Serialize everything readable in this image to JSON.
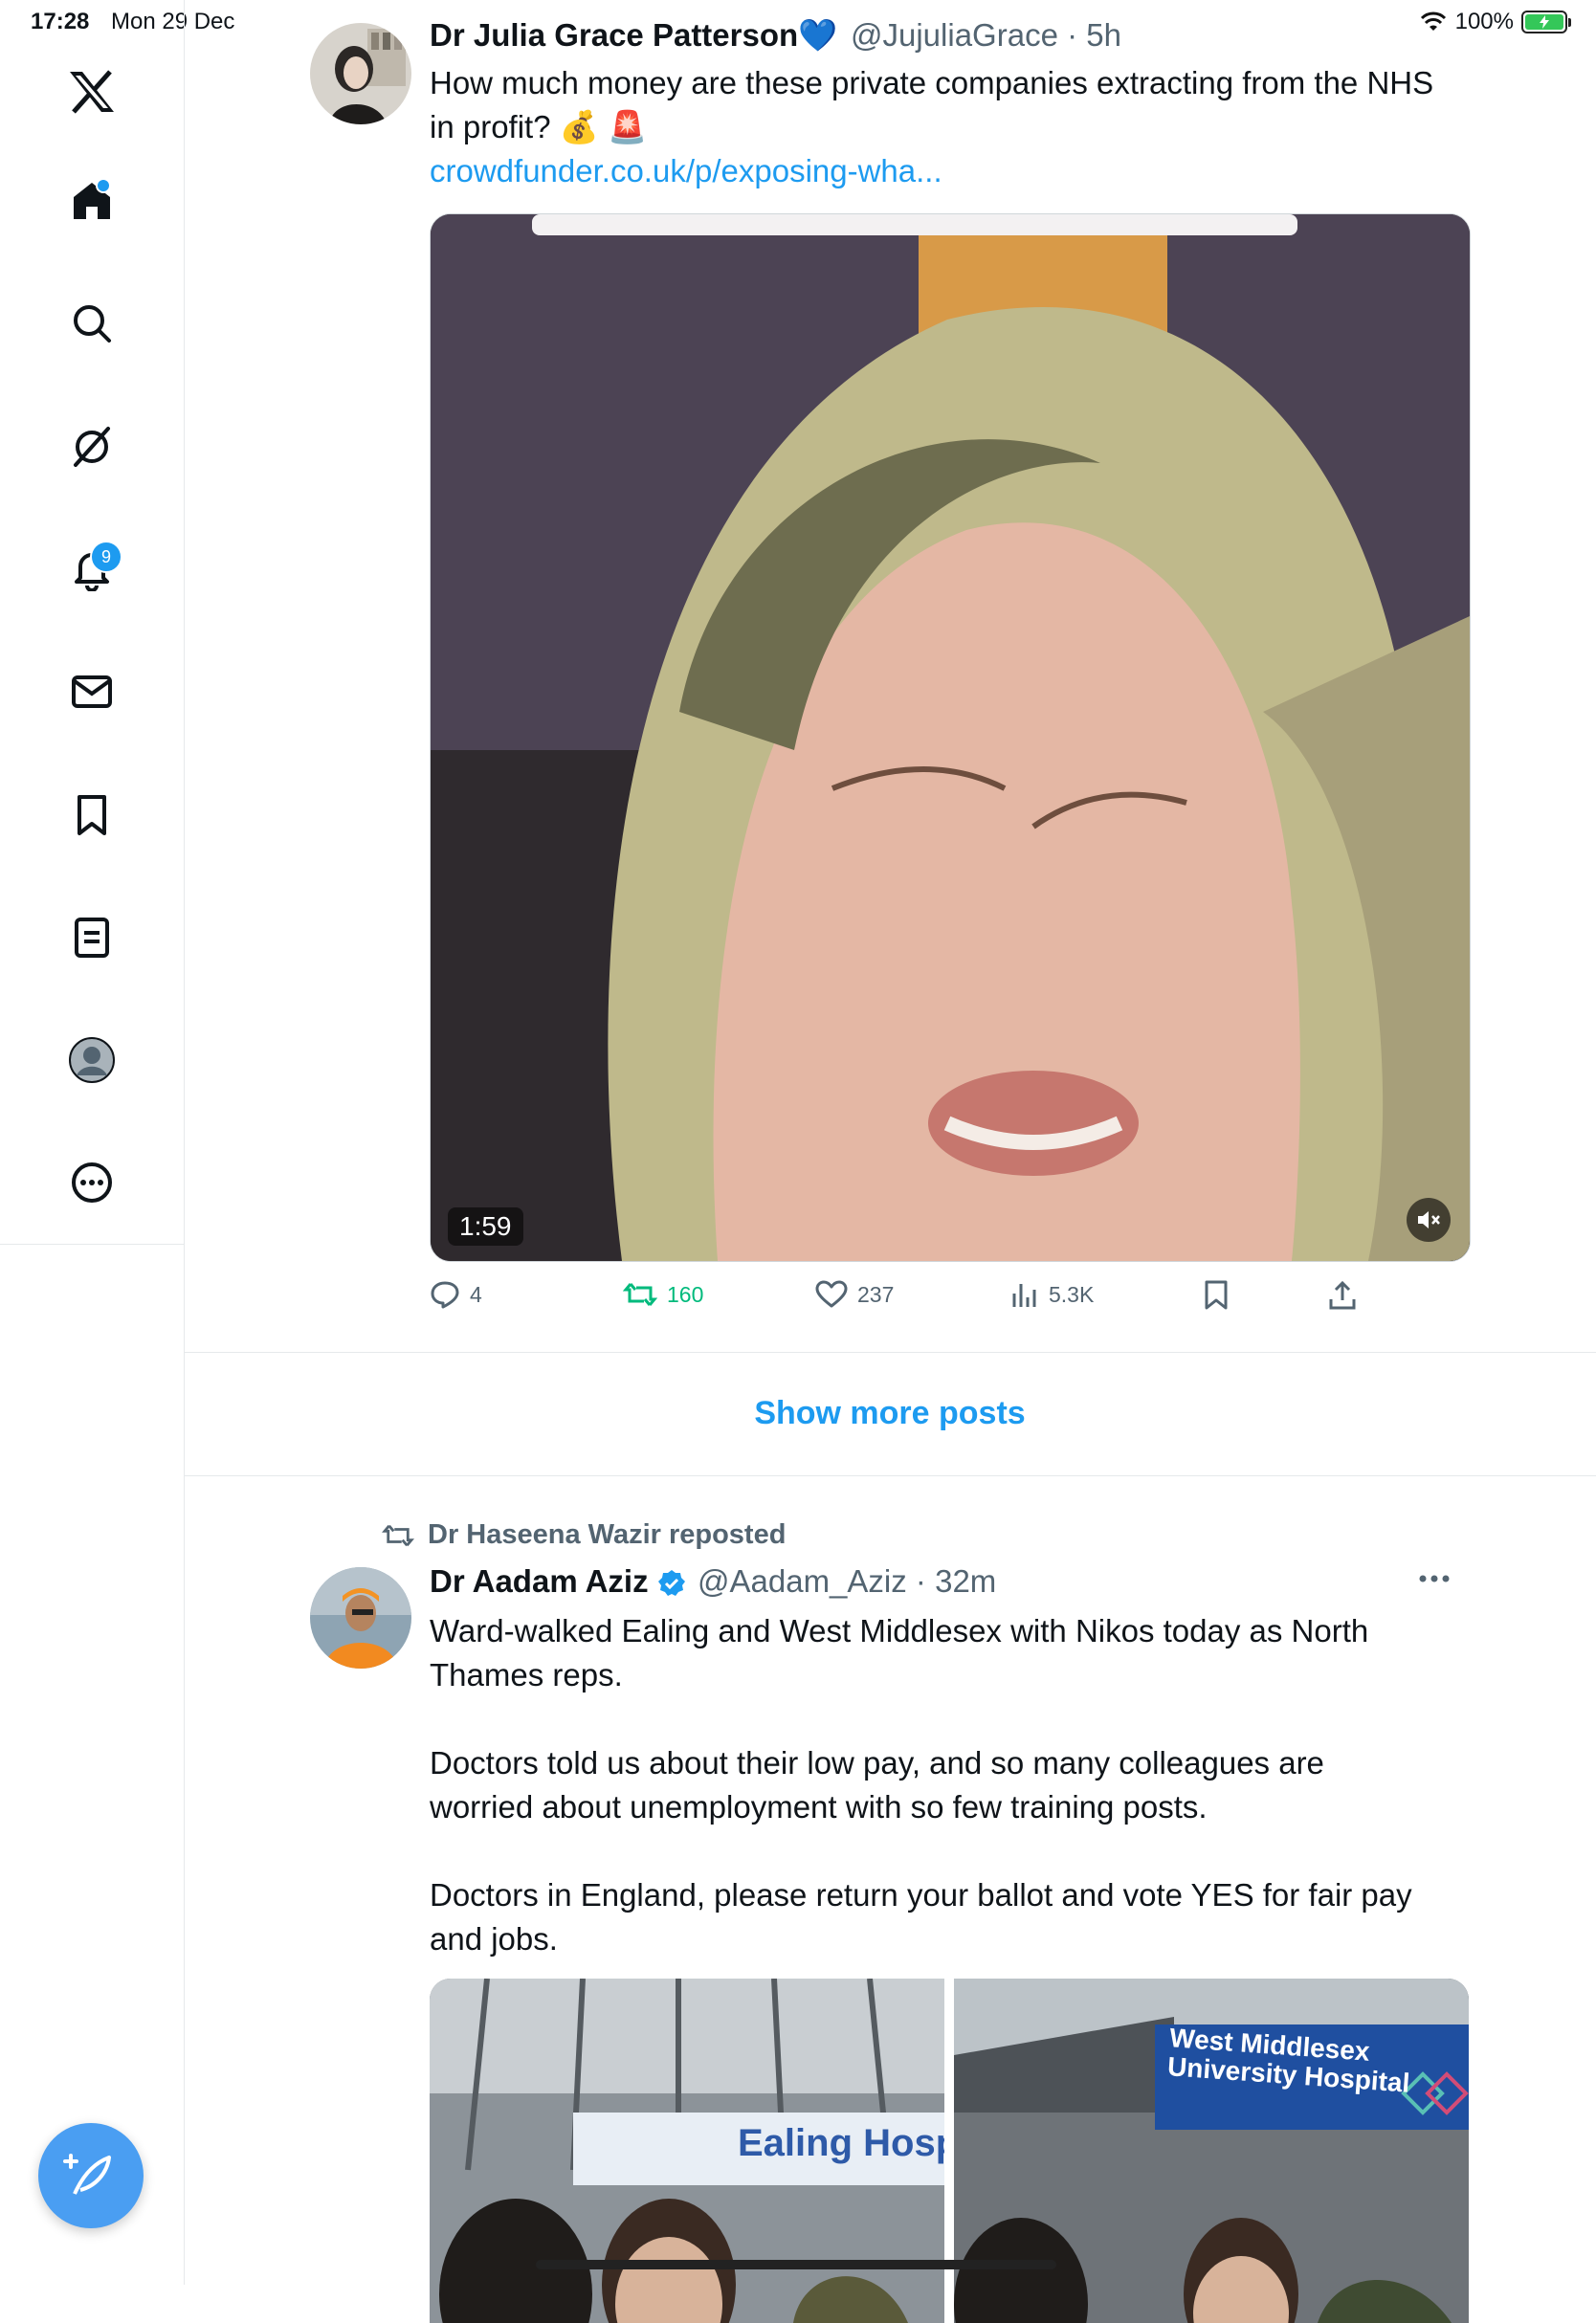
{
  "status_bar": {
    "time": "17:28",
    "date": "Mon 29 Dec",
    "battery": "100%"
  },
  "sidebar": {
    "items": [
      {
        "name": "home",
        "icon": "home-icon"
      },
      {
        "name": "explore",
        "icon": "search-icon"
      },
      {
        "name": "grok",
        "icon": "grok-icon"
      },
      {
        "name": "notifications",
        "icon": "bell-icon",
        "badge": "9"
      },
      {
        "name": "messages",
        "icon": "mail-icon"
      },
      {
        "name": "bookmarks",
        "icon": "bookmark-icon"
      },
      {
        "name": "lists",
        "icon": "list-icon"
      },
      {
        "name": "profile",
        "icon": "profile-icon"
      },
      {
        "name": "more",
        "icon": "more-circle-icon"
      }
    ],
    "compose_icon": "compose-icon"
  },
  "post1": {
    "name": "Dr Julia Grace Patterson",
    "emoji": "💙",
    "handle": "@JujuliaGrace",
    "time": "5h",
    "text_line1": "How much money are these private companies extracting from the NHS",
    "text_line2": "in profit? 💰 🚨",
    "link": "crowdfunder.co.uk/p/exposing-wha...",
    "video_duration": "1:59",
    "replies": "4",
    "reposts": "160",
    "likes": "237",
    "views": "5.3K"
  },
  "show_more": "Show more posts",
  "post2": {
    "reposted_by": "Dr Haseena Wazir reposted",
    "name": "Dr Aadam Aziz",
    "handle": "@Aadam_Aziz",
    "time": "32m",
    "para1_line1": "Ward-walked Ealing and West Middlesex with Nikos today as North",
    "para1_line2": "Thames reps.",
    "para2_line1": "Doctors told us about their low pay, and so many colleagues are",
    "para2_line2": "worried about unemployment with so few training posts.",
    "para3_line1": "Doctors in England, please return your ballot and vote YES for fair pay",
    "para3_line2": "and jobs.",
    "image1_sign": "Ealing Hospita",
    "image2_sign_line1": "West Middlesex",
    "image2_sign_line2": "University Hospital"
  },
  "colors": {
    "accent": "#1d9bf0",
    "repost_green": "#00ba7c",
    "muted": "#536471"
  }
}
